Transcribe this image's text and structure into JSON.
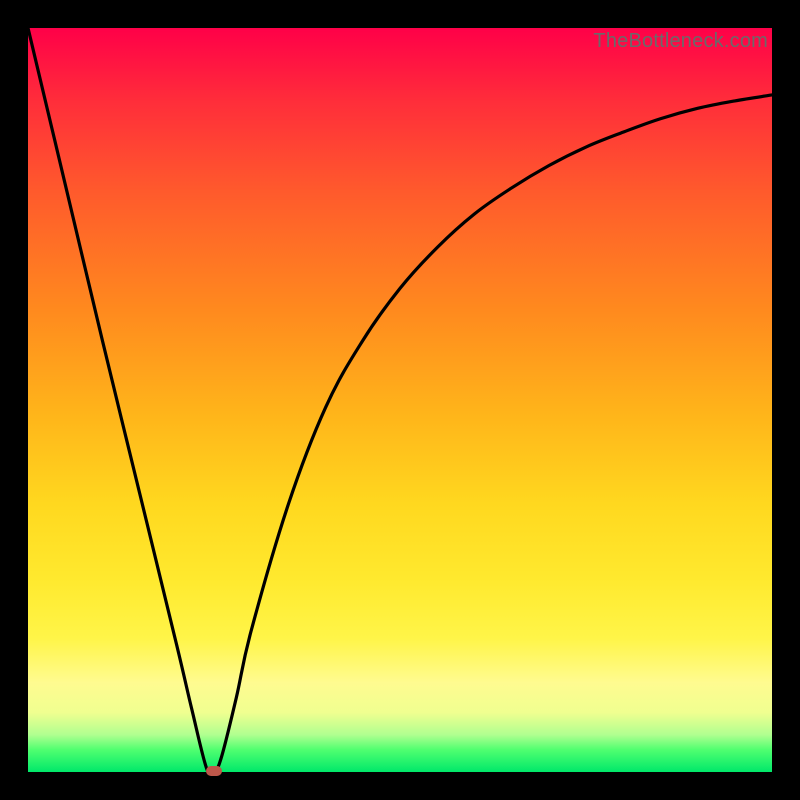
{
  "attribution": "TheBottleneck.com",
  "colors": {
    "frame": "#000000",
    "gradient_top": "#ff0048",
    "gradient_bottom": "#00e86a",
    "curve": "#000000",
    "nub": "#bd574a"
  },
  "chart_data": {
    "type": "line",
    "title": "",
    "xlabel": "",
    "ylabel": "",
    "xlim": [
      0,
      100
    ],
    "ylim": [
      0,
      100
    ],
    "grid": false,
    "legend": false,
    "x": [
      0,
      5,
      10,
      15,
      20,
      22,
      24,
      25,
      26,
      28,
      30,
      35,
      40,
      45,
      50,
      55,
      60,
      65,
      70,
      75,
      80,
      85,
      90,
      95,
      100
    ],
    "values": [
      100,
      79,
      58,
      37.5,
      17,
      8.5,
      0.5,
      0,
      2,
      10,
      19,
      36,
      49,
      58,
      65,
      70.5,
      75,
      78.5,
      81.5,
      84,
      86,
      87.8,
      89.2,
      90.2,
      91
    ],
    "marker": {
      "x": 25,
      "y": 0
    }
  }
}
